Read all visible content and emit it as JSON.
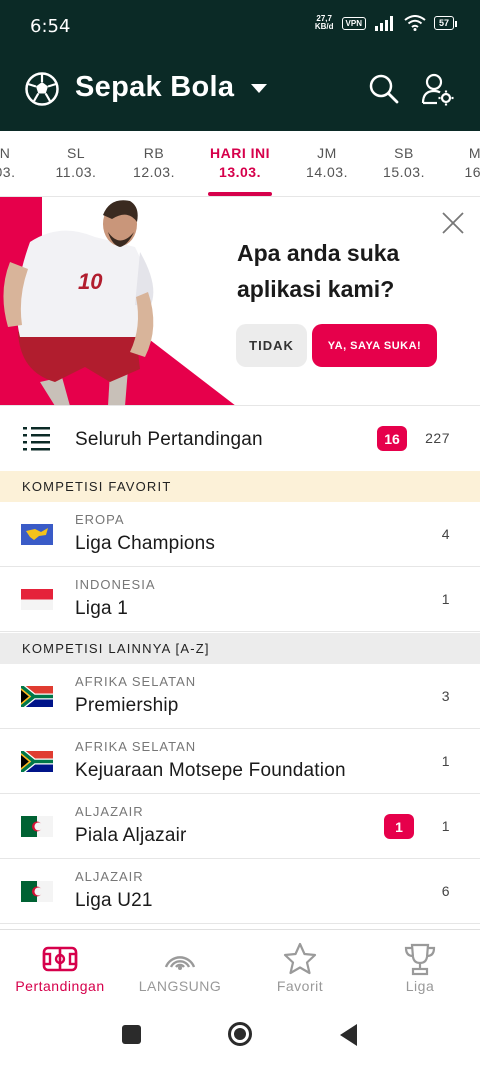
{
  "status_bar": {
    "time": "6:54",
    "speed_value": "27,7",
    "speed_unit": "KB/d",
    "vpn": "VPN",
    "battery": "57"
  },
  "app_bar": {
    "title": "Sepak Bola",
    "sport_icon": "soccer-ball-icon"
  },
  "dates": [
    {
      "day": "N",
      "date": "03."
    },
    {
      "day": "SL",
      "date": "11.03."
    },
    {
      "day": "RB",
      "date": "12.03."
    },
    {
      "day": "HARI INI",
      "date": "13.03.",
      "active": true
    },
    {
      "day": "JM",
      "date": "14.03."
    },
    {
      "day": "SB",
      "date": "15.03."
    },
    {
      "day": "M",
      "date": "16."
    }
  ],
  "promo": {
    "question": "Apa anda suka aplikasi kami?",
    "no_label": "TIDAK",
    "yes_label": "YA, SAYA SUKA!",
    "jersey_number": "10"
  },
  "all_matches": {
    "label": "Seluruh Pertandingan",
    "live_count": "16",
    "total_count": "227"
  },
  "sections": {
    "favorite": "KOMPETISI FAVORIT",
    "other": "KOMPETISI LAINNYA [A-Z]"
  },
  "favorite_competitions": [
    {
      "country": "EROPA",
      "name": "Liga Champions",
      "count": "4"
    },
    {
      "country": "INDONESIA",
      "name": "Liga 1",
      "count": "1"
    }
  ],
  "other_competitions": [
    {
      "country": "AFRIKA SELATAN",
      "name": "Premiership",
      "count": "3"
    },
    {
      "country": "AFRIKA SELATAN",
      "name": "Kejuaraan Motsepe Foundation",
      "count": "1"
    },
    {
      "country": "ALJAZAIR",
      "name": "Piala Aljazair",
      "live": "1",
      "count": "1"
    },
    {
      "country": "ALJAZAIR",
      "name": "Liga U21",
      "count": "6"
    }
  ],
  "bottom_nav": [
    {
      "label": "Pertandingan",
      "icon": "pitch-icon",
      "active": true
    },
    {
      "label": "LANGSUNG",
      "icon": "live-signal-icon"
    },
    {
      "label": "Favorit",
      "icon": "star-icon"
    },
    {
      "label": "Liga",
      "icon": "trophy-icon"
    }
  ],
  "colors": {
    "header_bg": "#0b2a26",
    "accent": "#e6004b",
    "favorite_section_bg": "#fcf1d8",
    "other_section_bg": "#ececec"
  }
}
